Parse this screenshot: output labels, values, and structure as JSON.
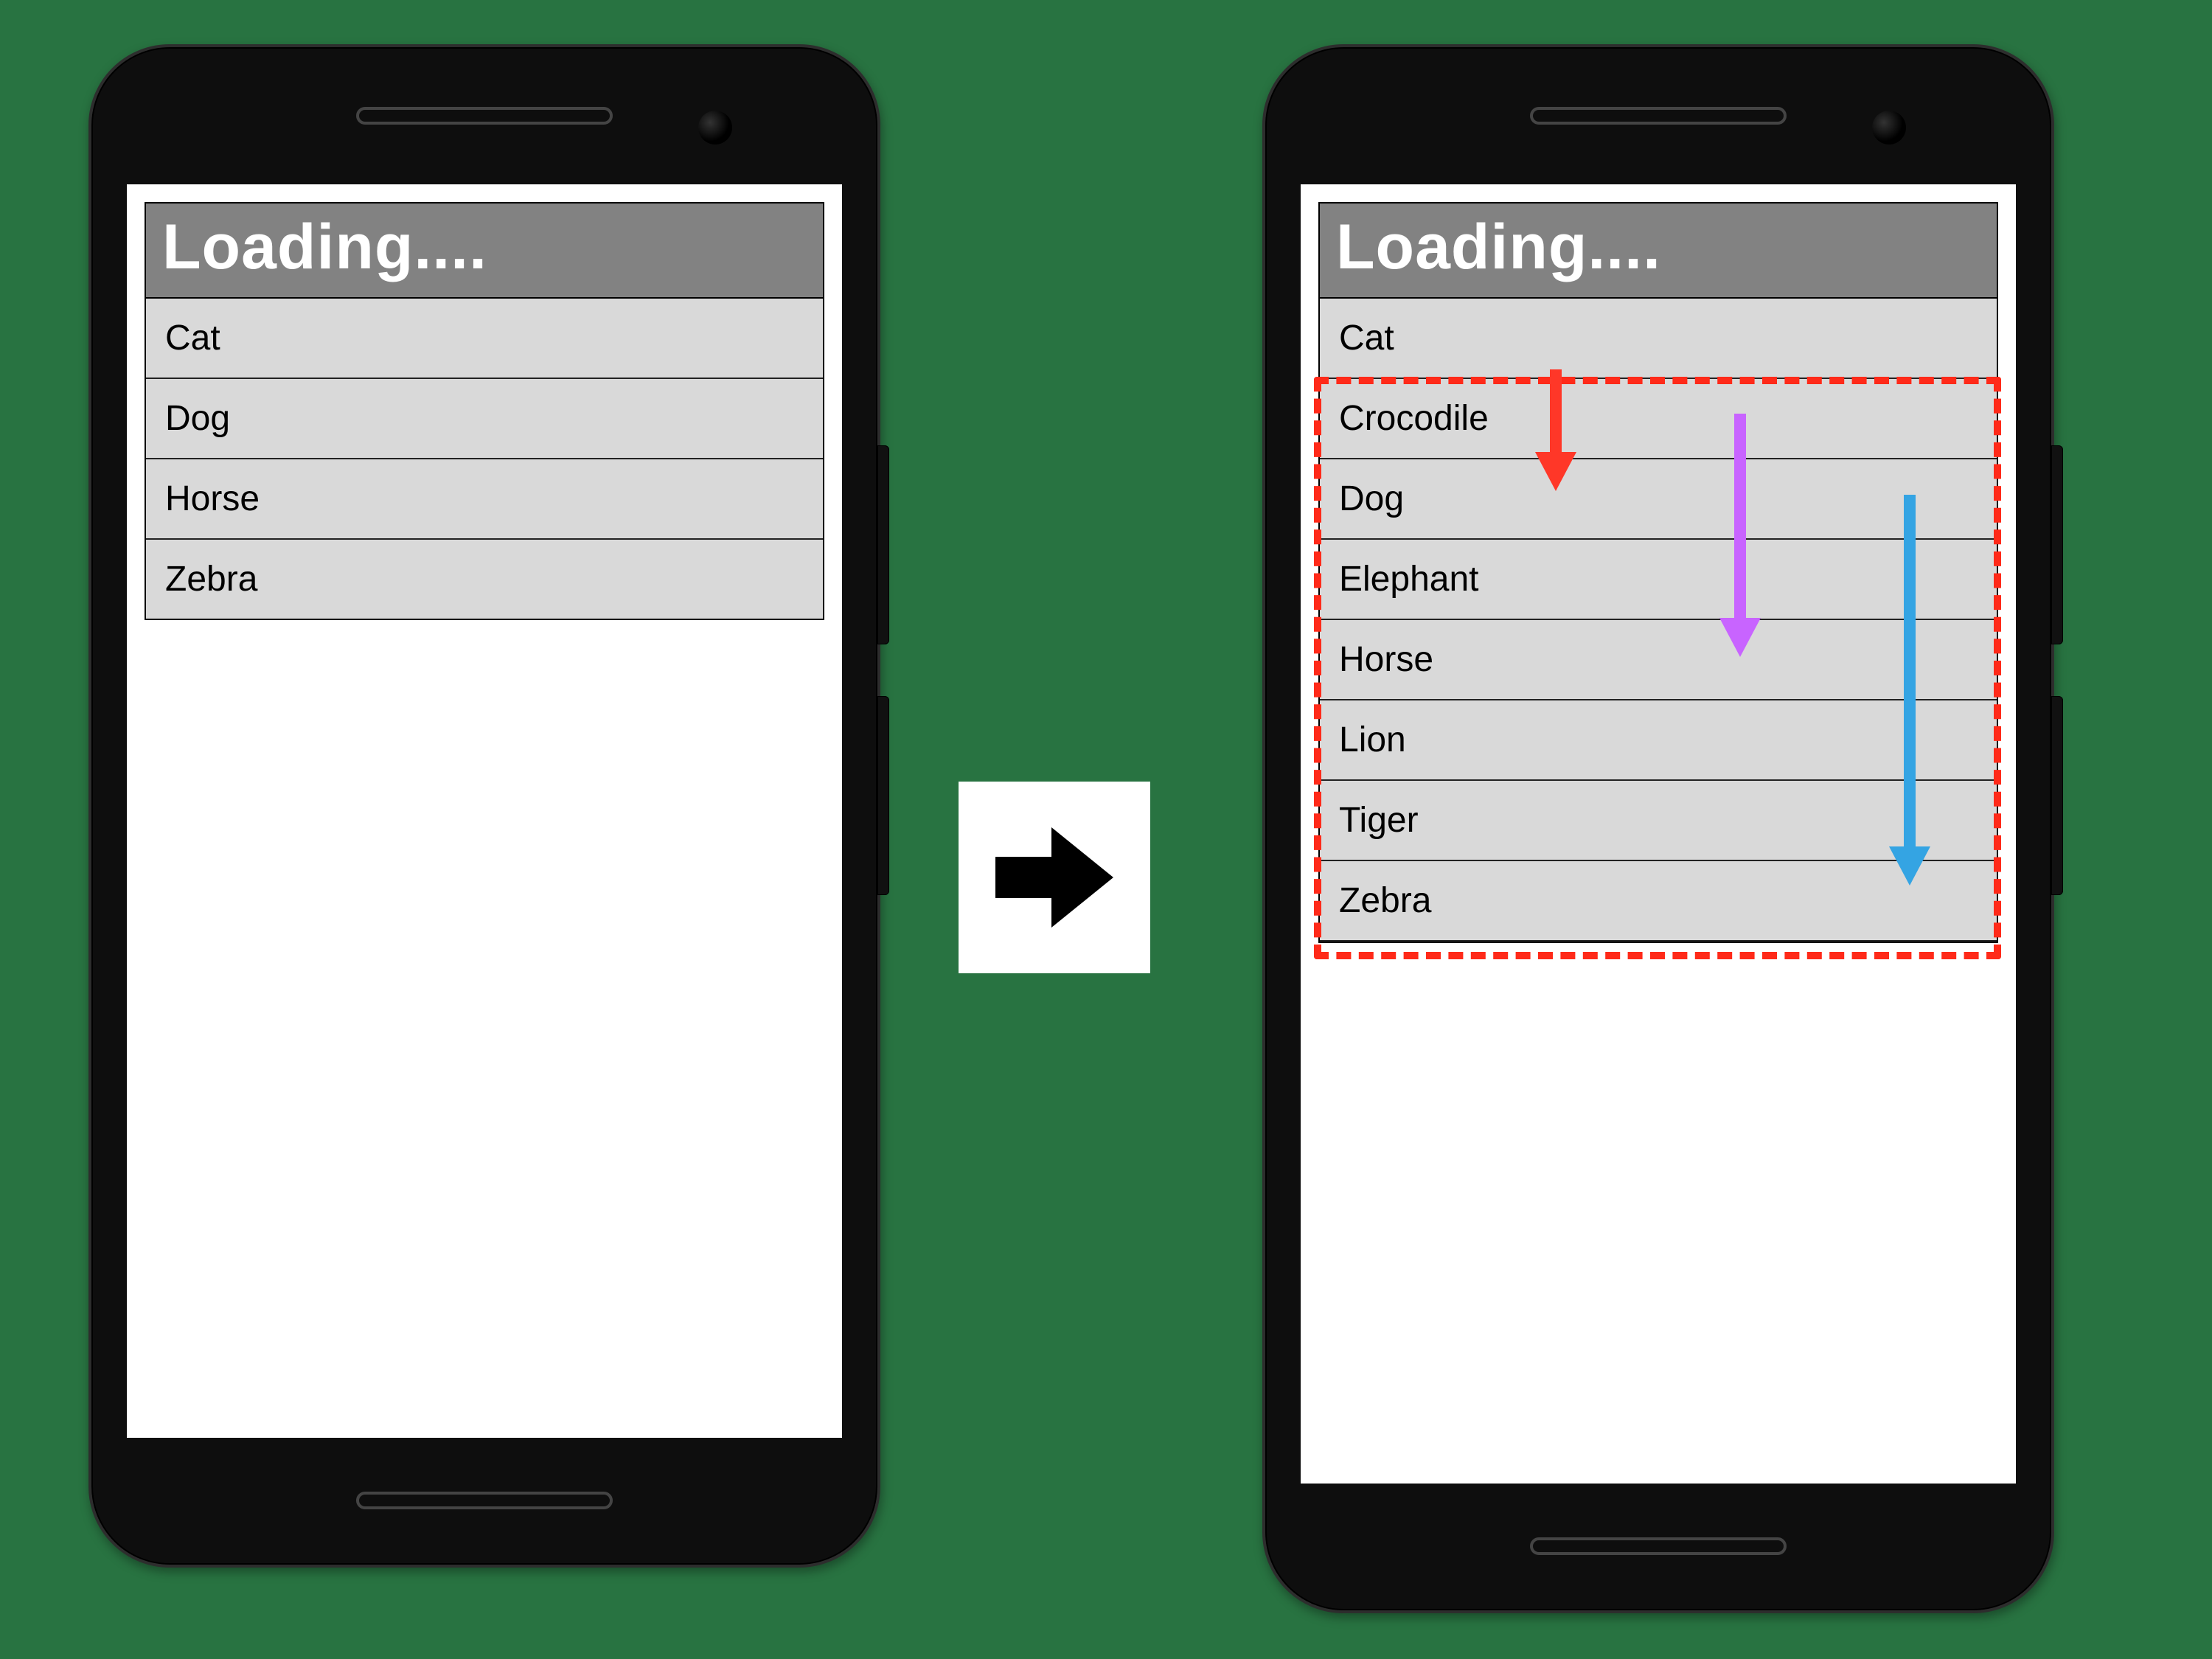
{
  "phones": {
    "left": {
      "header": "Loading....",
      "rows": [
        "Cat",
        "Dog",
        "Horse",
        "Zebra"
      ]
    },
    "right": {
      "header": "Loading....",
      "rows": [
        "Cat",
        "Crocodile",
        "Dog",
        "Elephant",
        "Horse",
        "Lion",
        "Tiger",
        "Zebra"
      ]
    }
  },
  "arrows": {
    "transition_icon": "arrow-right-icon",
    "insert_arrows": [
      {
        "name": "insert-arrow-short",
        "color": "#ff3728",
        "span_rows": 1
      },
      {
        "name": "insert-arrow-medium",
        "color": "#c864ff",
        "span_rows": 3
      },
      {
        "name": "insert-arrow-long",
        "color": "#34a4e3",
        "span_rows": 5
      }
    ]
  },
  "highlight": {
    "from_row_index": 1,
    "to_row_index": 7
  }
}
